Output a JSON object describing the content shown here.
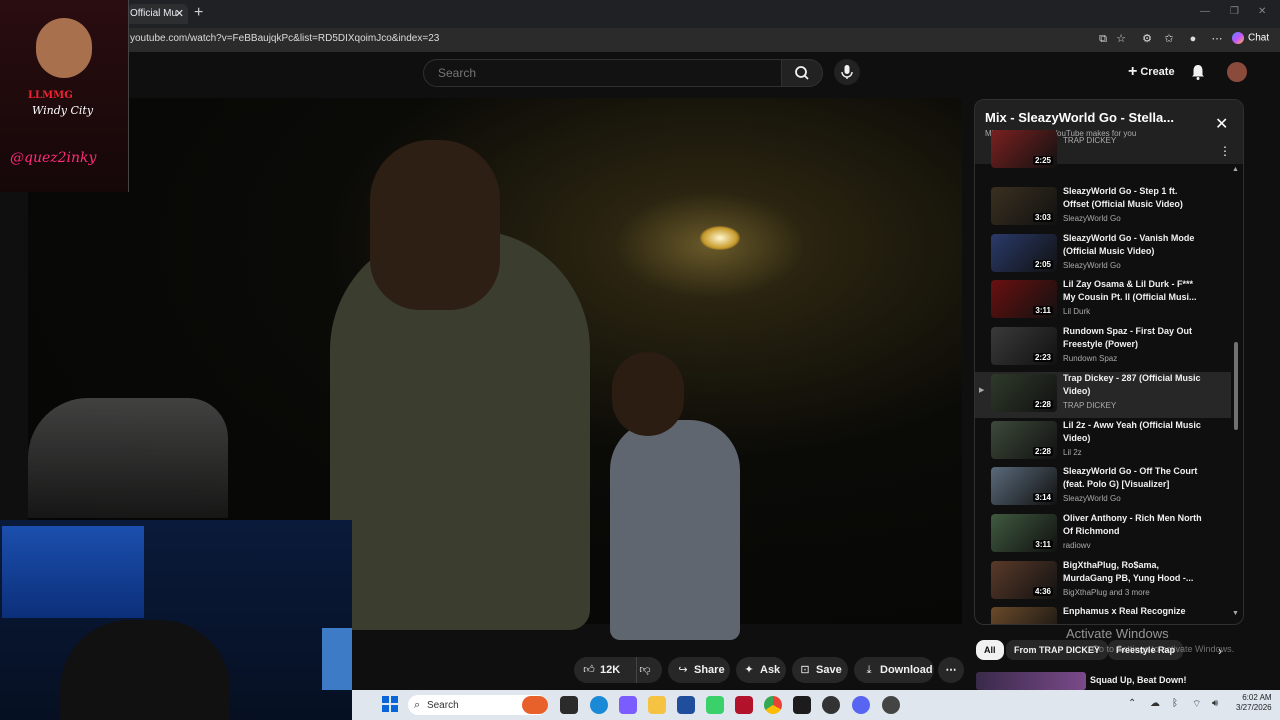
{
  "browser": {
    "tab_title": "Official Mu",
    "tab_close": "✕",
    "new_tab": "+",
    "url": "youtube.com/watch?v=FeBBaujqkPc&list=RD5DIXqoimJco&index=23",
    "chat_label": "Chat"
  },
  "youtube": {
    "search_placeholder": "Search",
    "create_label": "Create"
  },
  "overlay": {
    "brand_line1": "LLMMG",
    "brand_line2": "Windy City",
    "brand_handle": "@quez2inky"
  },
  "actions": {
    "likes": "12K",
    "share": "Share",
    "ask": "Ask",
    "save": "Save",
    "download": "Download"
  },
  "playlist": {
    "title": "Mix - SleazyWorld Go - Stella...",
    "subtitle": "Mixes are playlists YouTube makes for you",
    "items": [
      {
        "title": "",
        "channel": "TRAP DICKEY",
        "duration": "2:25"
      },
      {
        "title": "SleazyWorld Go - Step 1 ft. Offset (Official Music Video)",
        "channel": "SleazyWorld Go",
        "duration": "3:03"
      },
      {
        "title": "SleazyWorld Go - Vanish Mode (Official Music Video)",
        "channel": "SleazyWorld Go",
        "duration": "2:05"
      },
      {
        "title": "Lil Zay Osama & Lil Durk - F*** My Cousin Pt. II (Official Musi...",
        "channel": "Lil Durk",
        "duration": "3:11"
      },
      {
        "title": "Rundown Spaz - First Day Out Freestyle (Power)",
        "channel": "Rundown Spaz",
        "duration": "2:23"
      },
      {
        "title": "Trap Dickey - 287 (Official Music Video)",
        "channel": "TRAP DICKEY",
        "duration": "2:28",
        "active": true
      },
      {
        "title": "Lil 2z - Aww Yeah (Official Music Video)",
        "channel": "Lil 2z",
        "duration": "2:28"
      },
      {
        "title": "SleazyWorld Go - Off The Court (feat. Polo G) [Visualizer]",
        "channel": "SleazyWorld Go",
        "duration": "3:14"
      },
      {
        "title": "Oliver Anthony - Rich Men North Of Richmond",
        "channel": "radiowv",
        "duration": "3:11"
      },
      {
        "title": "BigXthaPlug, Ro$ama, MurdaGang PB, Yung Hood -...",
        "channel": "BigXthaPlug and 3 more",
        "duration": "4:36"
      },
      {
        "title": "Enphamus x Real Recognize",
        "channel": "",
        "duration": ""
      }
    ]
  },
  "chips": [
    "All",
    "From TRAP DICKEY",
    "Freestyle Rap"
  ],
  "next_video": "Squad Up, Beat Down!",
  "windows": {
    "activate_title": "Activate Windows",
    "activate_sub": "Go to Settings to activate Windows.",
    "search": "Search",
    "time": "6:02 AM",
    "date": "3/27/2026"
  },
  "colors": {
    "accent_red": "#ff0033",
    "panel_bg": "#212121",
    "taskbar_bg": "#dfe6ee"
  }
}
